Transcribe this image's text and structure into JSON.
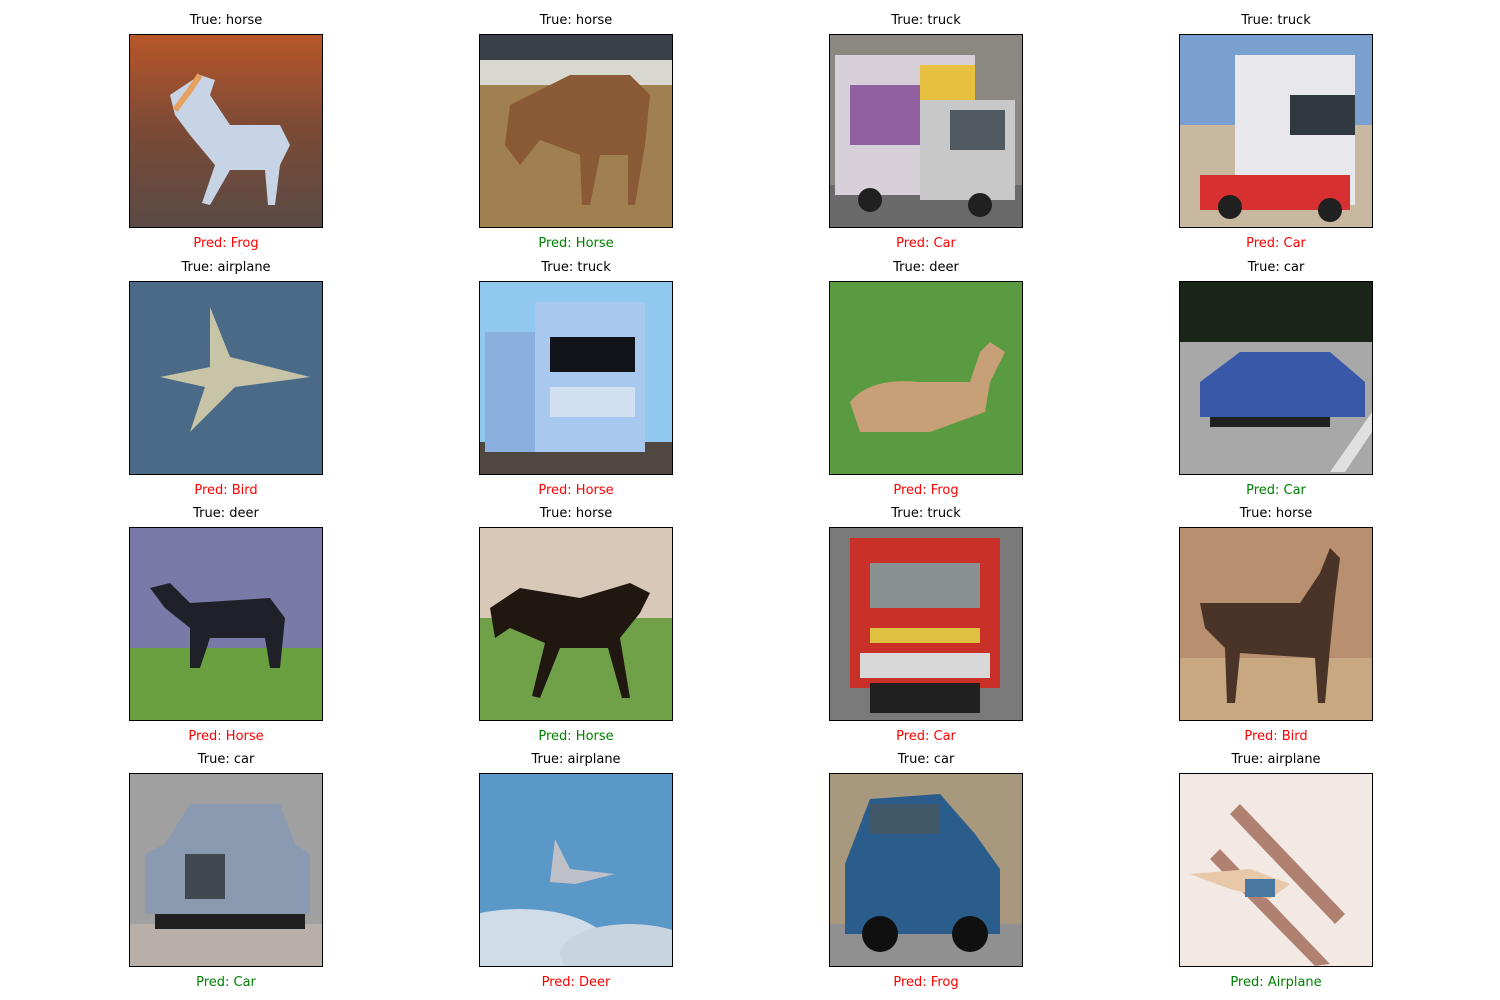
{
  "colors": {
    "correct": "#008000",
    "incorrect": "#ff0000"
  },
  "samples": [
    {
      "true_label": "True: horse",
      "pred_label": "Pred: Frog",
      "correct": false
    },
    {
      "true_label": "True: horse",
      "pred_label": "Pred: Horse",
      "correct": true
    },
    {
      "true_label": "True: truck",
      "pred_label": "Pred: Car",
      "correct": false
    },
    {
      "true_label": "True: truck",
      "pred_label": "Pred: Car",
      "correct": false
    },
    {
      "true_label": "True: airplane",
      "pred_label": "Pred: Bird",
      "correct": false
    },
    {
      "true_label": "True: truck",
      "pred_label": "Pred: Horse",
      "correct": false
    },
    {
      "true_label": "True: deer",
      "pred_label": "Pred: Frog",
      "correct": false
    },
    {
      "true_label": "True: car",
      "pred_label": "Pred: Car",
      "correct": true
    },
    {
      "true_label": "True: deer",
      "pred_label": "Pred: Horse",
      "correct": false
    },
    {
      "true_label": "True: horse",
      "pred_label": "Pred: Horse",
      "correct": true
    },
    {
      "true_label": "True: truck",
      "pred_label": "Pred: Car",
      "correct": false
    },
    {
      "true_label": "True: horse",
      "pred_label": "Pred: Bird",
      "correct": false
    },
    {
      "true_label": "True: car",
      "pred_label": "Pred: Car",
      "correct": true
    },
    {
      "true_label": "True: airplane",
      "pred_label": "Pred: Deer",
      "correct": false
    },
    {
      "true_label": "True: car",
      "pred_label": "Pred: Frog",
      "correct": false
    },
    {
      "true_label": "True: airplane",
      "pred_label": "Pred: Airplane",
      "correct": true
    }
  ]
}
